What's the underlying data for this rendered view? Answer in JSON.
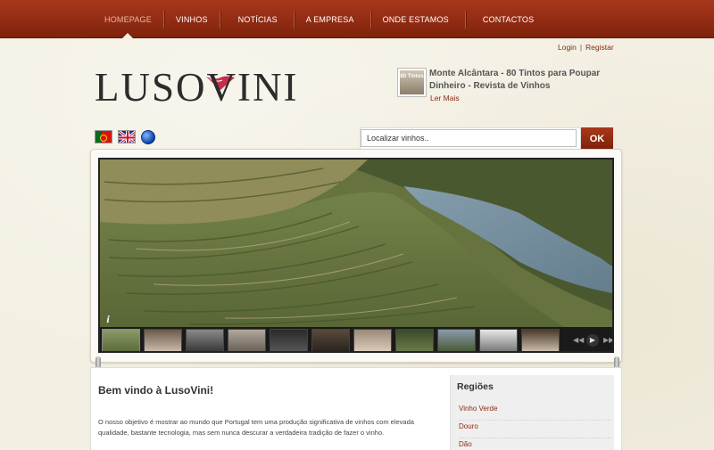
{
  "nav": {
    "items": [
      "HOMEPAGE",
      "VINHOS",
      "NOTÍCIAS",
      "A EMPRESA",
      "ONDE ESTAMOS",
      "CONTACTOS"
    ],
    "active_index": 0
  },
  "auth": {
    "login": "Login",
    "separator": "|",
    "register": "Registar"
  },
  "logo": {
    "part1": "LUSO",
    "part2": "V",
    "part3": "INI"
  },
  "news": {
    "thumb_text": "80 Tintos",
    "title": "Monte Alcântara - 80 Tintos para Poupar Dinheiro - Revista de Vinhos",
    "more": "Ler Mais"
  },
  "search": {
    "placeholder": "Localizar vinhos..",
    "value": "Localizar vinhos..",
    "button": "OK"
  },
  "slider": {
    "info_label": "i"
  },
  "welcome": {
    "title": "Bem vindo à LusoVini!",
    "text": "O nosso objetivo é mostrar ao mundo que Portugal tem uma produção significativa de vinhos com elevada qualidade, bastante tecnologia, mas sem nunca descurar a verdadeira tradição de fazer o vinho."
  },
  "sidebar": {
    "title": "Regiões",
    "items": [
      "Vinho Verde",
      "Douro",
      "Dão"
    ]
  },
  "colors": {
    "brand": "#8a2a10",
    "nav_bg": "#9a3015",
    "ok_button": "#8f2a10"
  },
  "icons": [
    "flag-portugal-icon",
    "flag-uk-icon",
    "globe-icon",
    "info-icon",
    "prev-icon",
    "play-icon",
    "next-icon"
  ]
}
